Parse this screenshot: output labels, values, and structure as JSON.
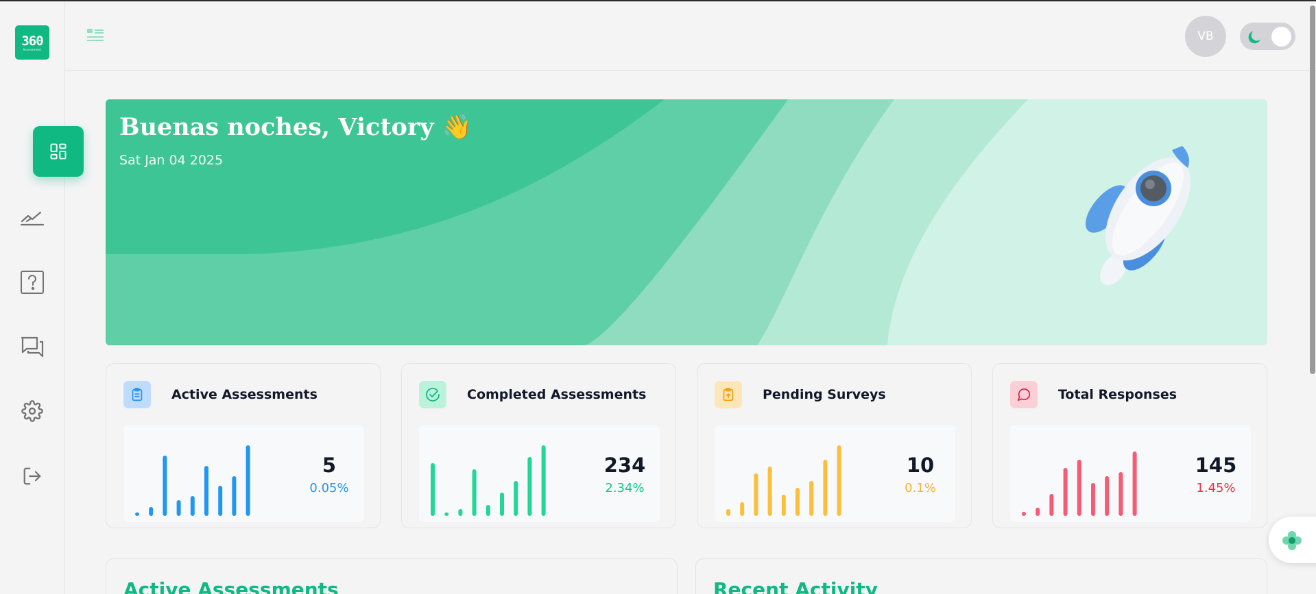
{
  "logo": {
    "main": "360",
    "sub": "Assessment"
  },
  "sidebar": {
    "items": [
      {
        "name": "dashboard",
        "icon": "dashboard-icon",
        "active": true
      },
      {
        "name": "assessments",
        "icon": "chart-line-icon",
        "active": false
      },
      {
        "name": "questions",
        "icon": "question-icon",
        "active": false
      },
      {
        "name": "messages",
        "icon": "chat-icon",
        "active": false
      },
      {
        "name": "settings",
        "icon": "gear-icon",
        "active": false
      },
      {
        "name": "logout",
        "icon": "logout-icon",
        "active": false
      }
    ]
  },
  "header": {
    "avatar_initials": "VB",
    "theme": "light"
  },
  "hero": {
    "greeting": "Buenas noches, Victory 👋",
    "date": "Sat Jan 04 2025"
  },
  "stats": [
    {
      "title": "Active Assessments",
      "value": "5",
      "change": "0.05%",
      "color": "#2196f3",
      "icon_bg": "#bfdbfe",
      "icon": "clipboard-icon",
      "bars": [
        5,
        13,
        88,
        23,
        29,
        73,
        44,
        58,
        103
      ]
    },
    {
      "title": "Completed Assessments",
      "value": "234",
      "change": "2.34%",
      "color": "#22d696",
      "icon_bg": "#bbf2dc",
      "icon": "check-circle-icon",
      "bars": [
        77,
        5,
        10,
        68,
        16,
        34,
        51,
        86,
        103
      ]
    },
    {
      "title": "Pending Surveys",
      "value": "10",
      "change": "0.1%",
      "color": "#fbbf3c",
      "icon_bg": "#fde7b8",
      "icon": "clipboard-upload-icon",
      "bars": [
        10,
        20,
        62,
        72,
        31,
        41,
        51,
        82,
        103
      ]
    },
    {
      "title": "Total Responses",
      "value": "145",
      "change": "1.45%",
      "color": "#f55b74",
      "icon_bg": "#fccfd7",
      "icon": "message-circle-icon",
      "bars": [
        6,
        12,
        32,
        70,
        82,
        48,
        58,
        64,
        94
      ]
    }
  ],
  "panels": [
    {
      "title": "Active Assessments"
    },
    {
      "title": "Recent Activity"
    }
  ]
}
